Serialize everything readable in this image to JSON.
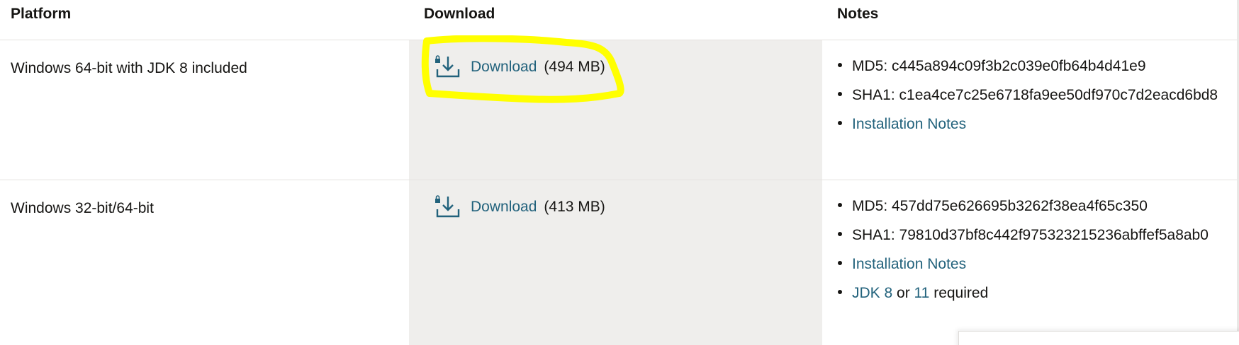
{
  "table": {
    "headers": {
      "platform": "Platform",
      "download": "Download",
      "notes": "Notes"
    },
    "rows": [
      {
        "platform": "Windows 64-bit with JDK 8 included",
        "download_label": "Download",
        "size": "(494 MB)",
        "md5": "MD5: c445a894c09f3b2c039e0fb64b4d41e9",
        "sha1": "SHA1: c1ea4ce7c25e6718fa9ee50df970c7d2eacd6bd8",
        "installation_notes": "Installation Notes"
      },
      {
        "platform": "Windows 32-bit/64-bit",
        "download_label": "Download",
        "size": "(413 MB)",
        "md5": "MD5: 457dd75e626695b3262f38ea4f65c350",
        "sha1": "SHA1: 79810d37bf8c442f975323215236abffef5a8ab0",
        "installation_notes": "Installation Notes",
        "requirement": {
          "jdk8": "JDK 8",
          "or": "or",
          "jdk11": "11",
          "suffix": "required"
        }
      }
    ]
  },
  "icons": {
    "download": "download-lock-icon"
  },
  "colors": {
    "link": "#22627c",
    "download_column_bg": "#efeeec",
    "highlight": "#ffff00"
  }
}
